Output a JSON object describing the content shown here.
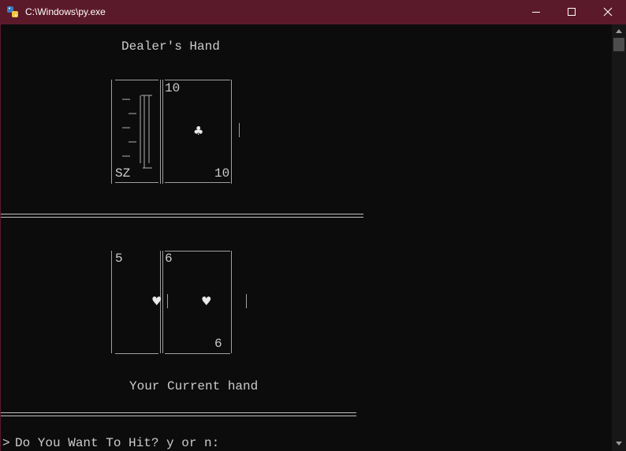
{
  "window": {
    "title": "C:\\Windows\\py.exe",
    "icons": {
      "app": "python-icon",
      "minimize": "minimize-icon",
      "maximize": "maximize-icon",
      "close": "close-icon"
    }
  },
  "console": {
    "dealer_heading": "Dealer's Hand",
    "dealer_cards": [
      {
        "state": "face-down",
        "corner_text": "SZ"
      },
      {
        "rank": "10",
        "suit": "♣",
        "suit_name": "clubs"
      }
    ],
    "player_cards": [
      {
        "rank": "5",
        "suit": "♥",
        "suit_name": "hearts"
      },
      {
        "rank": "6",
        "suit": "♥",
        "suit_name": "hearts"
      }
    ],
    "player_heading": "Your Current hand",
    "prompt": "Do You Want To Hit? y or n:",
    "prompt_marker": ">"
  },
  "colors": {
    "titlebar": "#5b1a2a",
    "console_bg": "#0c0c0c",
    "console_text": "#cccccc"
  }
}
